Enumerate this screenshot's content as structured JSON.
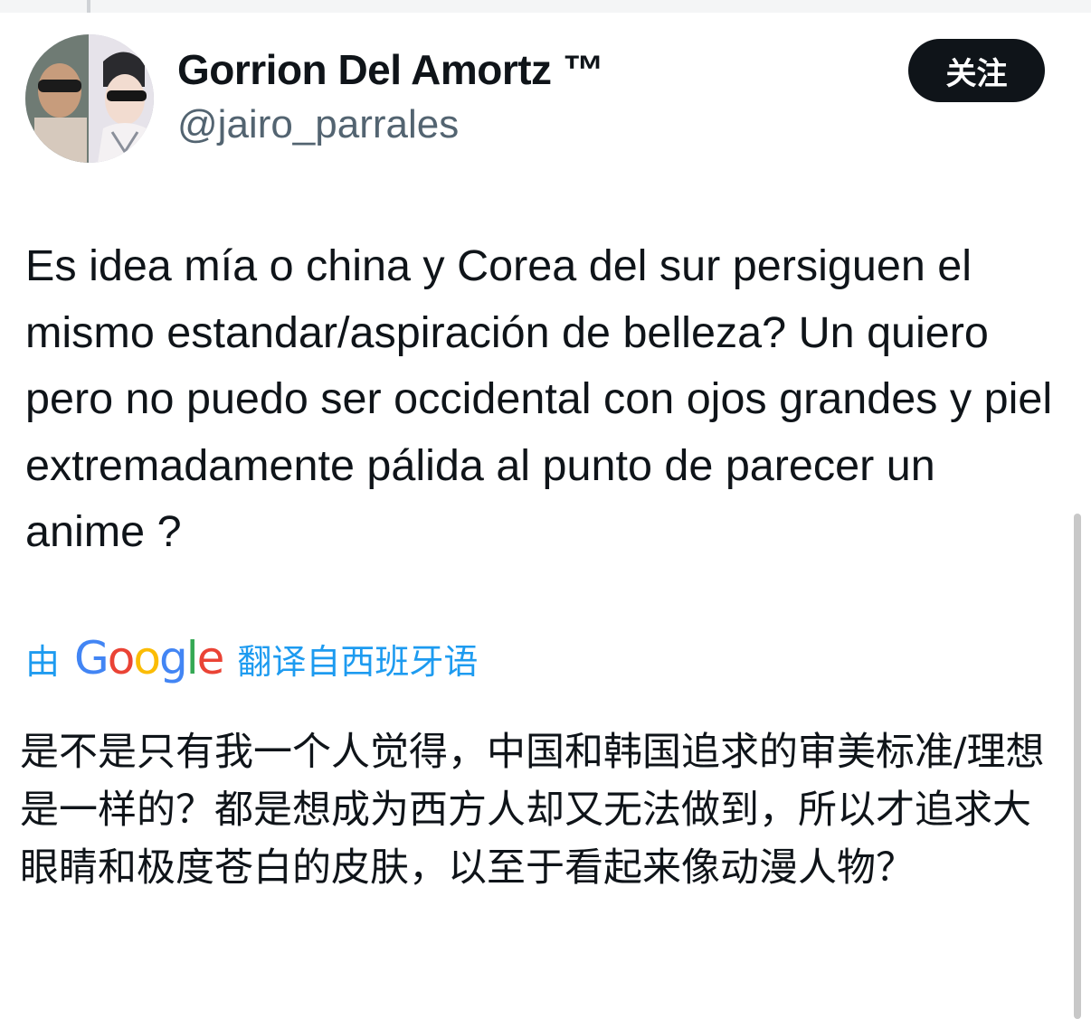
{
  "author": {
    "display_name": "Gorrion Del Amortz ™",
    "handle": "@jairo_parrales",
    "avatar": "profile-photo"
  },
  "follow_button": {
    "label": "关注"
  },
  "tweet": {
    "text": "Es idea mía o china y Corea del sur persiguen el mismo estandar/aspiración de belleza? Un quiero pero no puedo ser occidental con ojos grandes y piel extremadamente pálida al punto de parecer un anime ?"
  },
  "translation": {
    "by_label": "由",
    "provider_letters": [
      "G",
      "o",
      "o",
      "g",
      "l",
      "e"
    ],
    "provider_colors": [
      "#4285f4",
      "#ea4335",
      "#fbbc05",
      "#4285f4",
      "#34a853",
      "#ea4335"
    ],
    "source_label": "翻译自西班牙语",
    "text": "是不是只有我一个人觉得，中国和韩国追求的审美标准/理想是一样的？都是想成为西方人却又无法做到，所以才追求大眼睛和极度苍白的皮肤，以至于看起来像动漫人物？"
  },
  "colors": {
    "accent": "#1d9bf0",
    "text_primary": "#0f1419",
    "text_secondary": "#536471",
    "button_bg": "#0f1419"
  }
}
